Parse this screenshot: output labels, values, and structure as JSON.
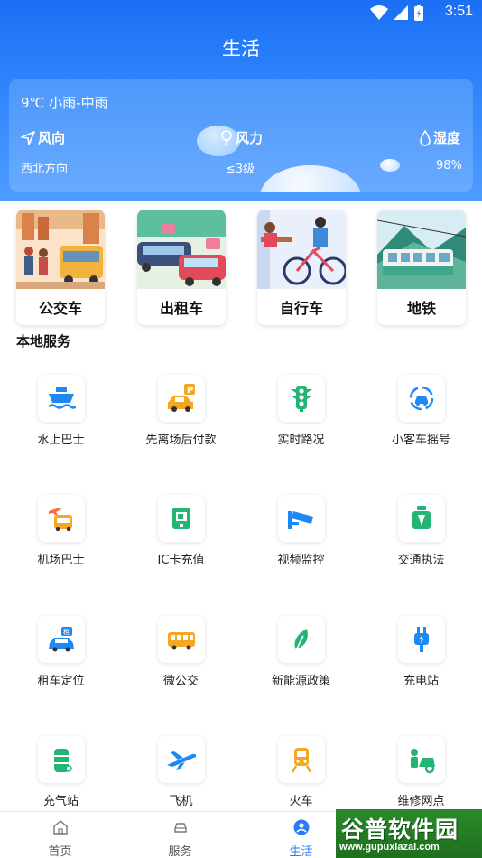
{
  "status_bar": {
    "time": "3:51"
  },
  "header": {
    "title": "生活"
  },
  "weather": {
    "condition": "9℃ 小雨-中雨",
    "wind_direction_label": "风向",
    "wind_direction_value": "西北方向",
    "wind_force_label": "风力",
    "wind_force_value": "≤3级",
    "humidity_label": "湿度",
    "humidity_value": "98%"
  },
  "transport": [
    {
      "label": "公交车"
    },
    {
      "label": "出租车"
    },
    {
      "label": "自行车"
    },
    {
      "label": "地铁"
    }
  ],
  "section": {
    "title": "本地服务"
  },
  "services": [
    {
      "label": "水上巴士",
      "icon": "ferry-icon"
    },
    {
      "label": "先离场后付款",
      "icon": "parking-car-icon"
    },
    {
      "label": "实时路况",
      "icon": "traffic-light-icon"
    },
    {
      "label": "小客车摇号",
      "icon": "car-lottery-icon"
    },
    {
      "label": "机场巴士",
      "icon": "airport-bus-icon"
    },
    {
      "label": "IC卡充值",
      "icon": "ic-card-icon"
    },
    {
      "label": "视频监控",
      "icon": "camera-icon"
    },
    {
      "label": "交通执法",
      "icon": "traffic-police-icon"
    },
    {
      "label": "租车定位",
      "icon": "rental-car-icon"
    },
    {
      "label": "微公交",
      "icon": "mini-bus-icon"
    },
    {
      "label": "新能源政策",
      "icon": "leaf-icon"
    },
    {
      "label": "充电站",
      "icon": "charging-plug-icon"
    },
    {
      "label": "充气站",
      "icon": "gas-tank-icon"
    },
    {
      "label": "飞机",
      "icon": "airplane-icon"
    },
    {
      "label": "火车",
      "icon": "train-icon"
    },
    {
      "label": "维修网点",
      "icon": "repair-icon"
    }
  ],
  "bottom_nav": [
    {
      "label": "首页",
      "icon": "home-icon",
      "active": false
    },
    {
      "label": "服务",
      "icon": "car-service-icon",
      "active": false
    },
    {
      "label": "生活",
      "icon": "user-life-icon",
      "active": true
    },
    {
      "label": "",
      "icon": "",
      "active": false
    }
  ],
  "watermark": {
    "title": "谷普软件园",
    "url": "www.gupuxiazai.com"
  },
  "colors": {
    "primary": "#2a7cf6",
    "header_top": "#1a6ff5",
    "header_bottom": "#4d9cff",
    "icon_blue": "#1e88f5",
    "icon_green": "#22b573",
    "icon_orange": "#f5a623"
  }
}
